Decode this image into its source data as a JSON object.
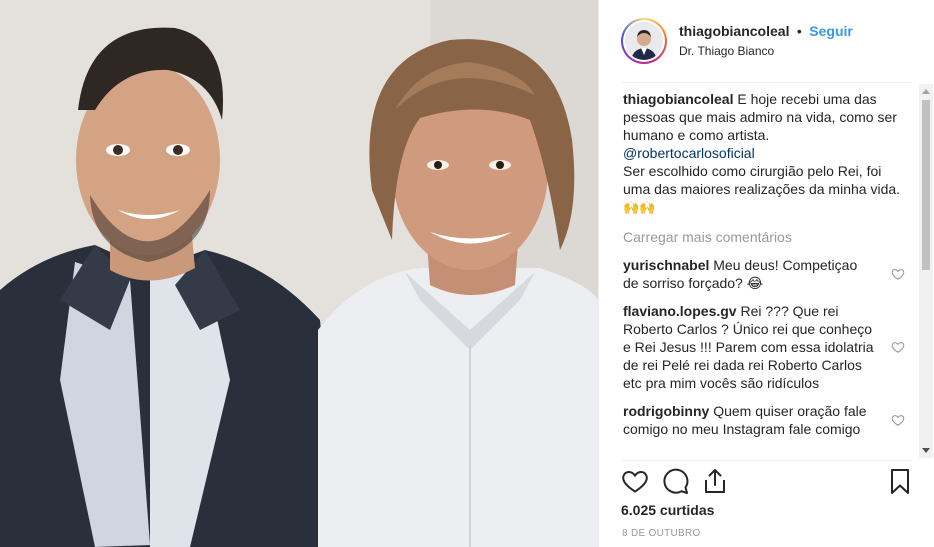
{
  "post": {
    "username": "thiagobiancoleal",
    "separator": "•",
    "follow_label": "Seguir",
    "display_name": "Dr. Thiago Bianco",
    "caption": {
      "username": "thiagobiancoleal",
      "line1": "E hoje recebi uma das pessoas que mais admiro na vida, como ser humano e como artista.",
      "mention": "@robertocarlosoficial",
      "line2": "Ser escolhido como cirurgião pelo Rei, foi uma das maiores realizações da minha vida.",
      "emojis": "🙌🙌"
    },
    "load_more_label": "Carregar mais comentários",
    "comments": [
      {
        "username": "yurischnabel",
        "text": "Meu deus! Competiçao de sorriso forçado? 😂"
      },
      {
        "username": "flaviano.lopes.gv",
        "text": "Rei ??? Que rei Roberto Carlos ? Único rei que conheço e Rei Jesus !!! Parem com essa idolatria de rei Pelé rei dada rei Roberto Carlos etc pra mim vocês são ridículos"
      },
      {
        "username": "rodrigobinny",
        "text": "Quem quiser oração fale comigo no meu Instagram fale comigo"
      }
    ],
    "likes": "6.025 curtidas",
    "date": "8 DE OUTUBRO"
  },
  "icons": {
    "like": "heart-icon",
    "comment": "comment-icon",
    "share": "share-icon",
    "save": "bookmark-icon",
    "comment_like": "heart-icon"
  },
  "colors": {
    "link": "#3897f0",
    "mention": "#003569",
    "muted": "#999999",
    "text": "#262626"
  }
}
